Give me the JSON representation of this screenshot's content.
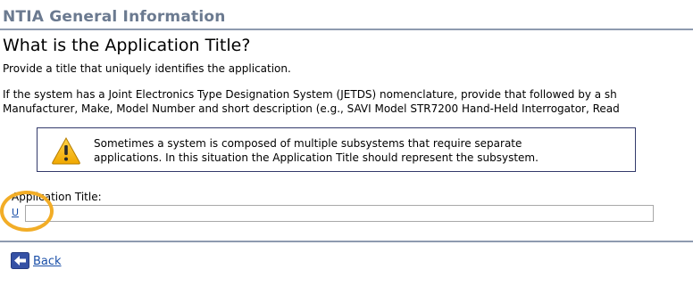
{
  "section": {
    "title": "NTIA General Information"
  },
  "question": {
    "heading": "What is the Application Title?",
    "intro": "Provide a title that uniquely identifies the application.",
    "detail_line1": "If the system has a Joint Electronics Type Designation System (JETDS) nomenclature, provide that followed by a sh",
    "detail_line2": "Manufacturer, Make, Model Number and short description (e.g., SAVI Model STR7200 Hand-Held Interrogator, Read"
  },
  "notice": {
    "icon": "warning-triangle-icon",
    "line1": "Sometimes a system is composed of multiple subsystems that require separate",
    "line2": "applications. In this situation the Application Title should represent the subsystem."
  },
  "field": {
    "label": "Application Title:",
    "u_link": "U",
    "value": "",
    "placeholder": ""
  },
  "nav": {
    "back_label": "Back",
    "back_icon": "arrow-left-icon"
  },
  "colors": {
    "section_title": "#6b7a90",
    "divider": "#8e9aaf",
    "link": "#1a4fa8",
    "highlight": "#f2ad27",
    "warning": "#f0b400"
  }
}
